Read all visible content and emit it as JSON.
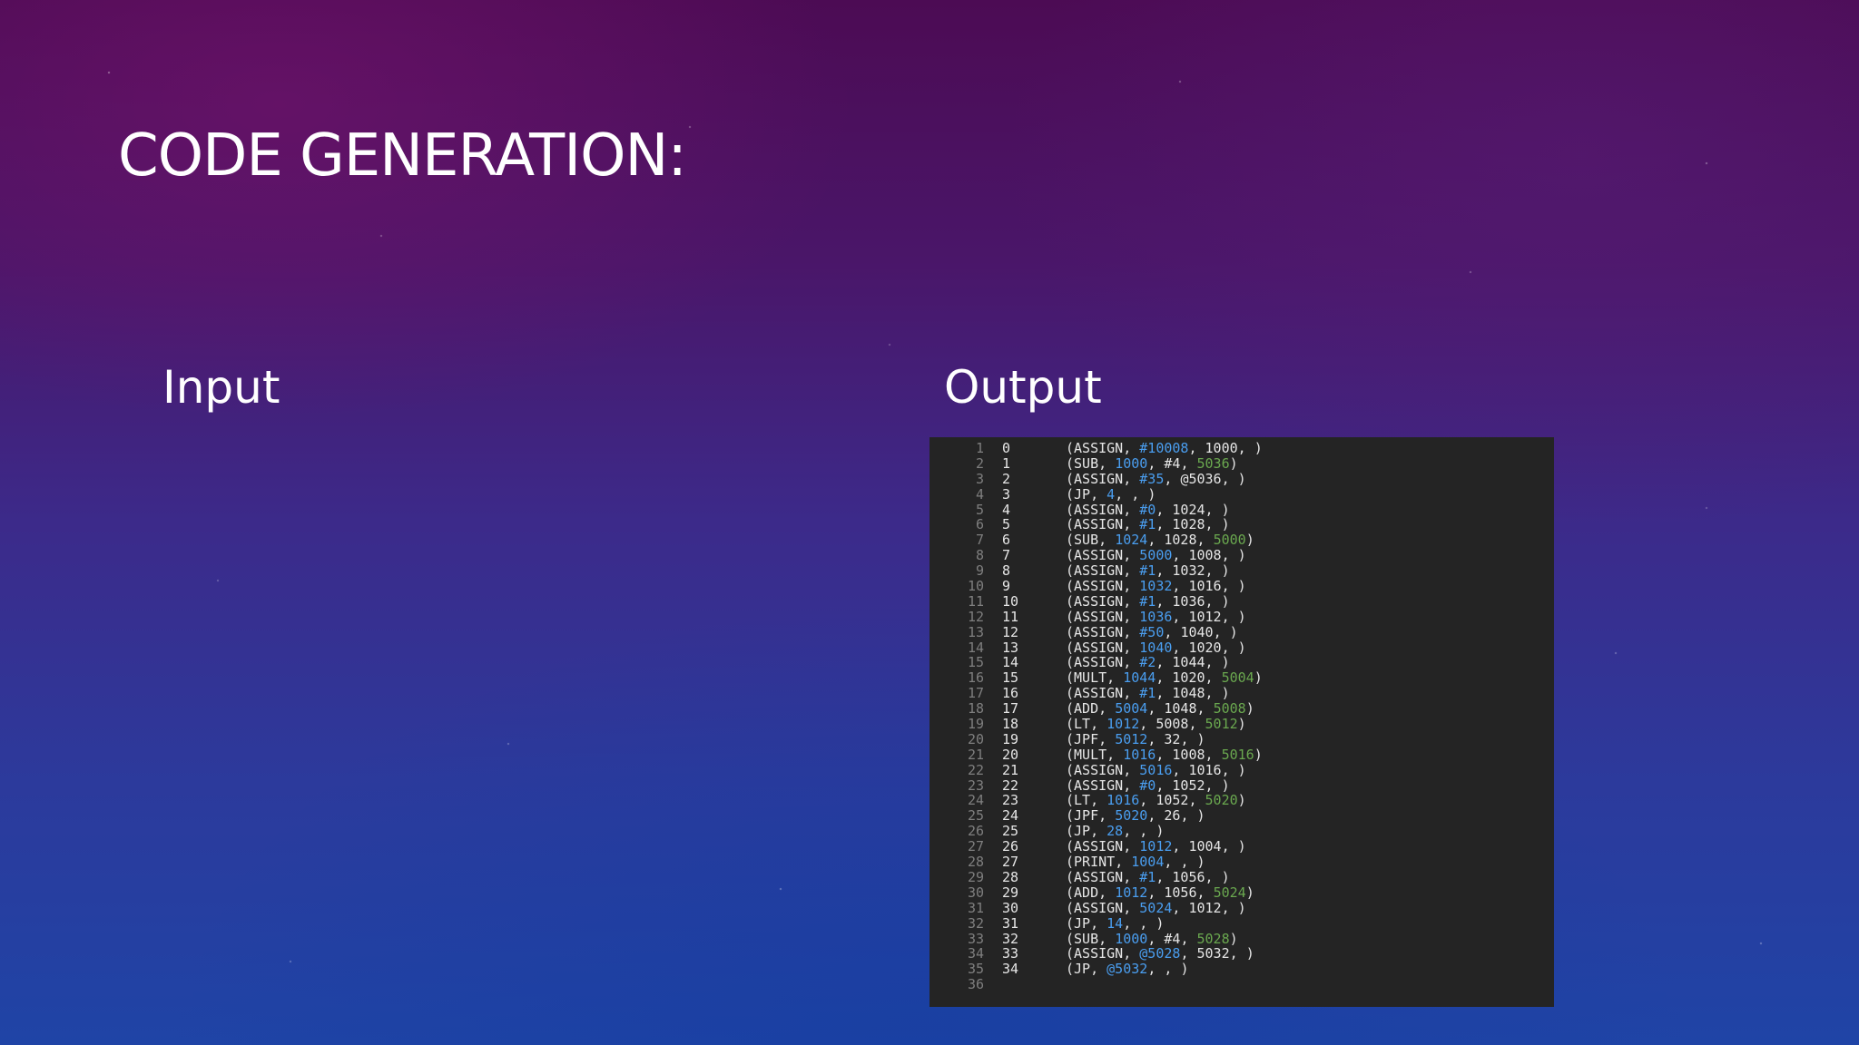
{
  "slide": {
    "title": "CODE GENERATION:",
    "input_heading": "Input",
    "output_heading": "Output"
  },
  "code": {
    "lines": [
      {
        "ln": "1",
        "idx": "0",
        "op": "ASSIGN",
        "a": "#10008",
        "b": "1000",
        "c": ""
      },
      {
        "ln": "2",
        "idx": "1",
        "op": "SUB",
        "a": "1000",
        "b": "#4",
        "c": "5036"
      },
      {
        "ln": "3",
        "idx": "2",
        "op": "ASSIGN",
        "a": "#35",
        "b": "@5036",
        "c": ""
      },
      {
        "ln": "4",
        "idx": "3",
        "op": "JP",
        "a": "4",
        "b": "",
        "c": ""
      },
      {
        "ln": "5",
        "idx": "4",
        "op": "ASSIGN",
        "a": "#0",
        "b": "1024",
        "c": ""
      },
      {
        "ln": "6",
        "idx": "5",
        "op": "ASSIGN",
        "a": "#1",
        "b": "1028",
        "c": ""
      },
      {
        "ln": "7",
        "idx": "6",
        "op": "SUB",
        "a": "1024",
        "b": "1028",
        "c": "5000"
      },
      {
        "ln": "8",
        "idx": "7",
        "op": "ASSIGN",
        "a": "5000",
        "b": "1008",
        "c": ""
      },
      {
        "ln": "9",
        "idx": "8",
        "op": "ASSIGN",
        "a": "#1",
        "b": "1032",
        "c": ""
      },
      {
        "ln": "10",
        "idx": "9",
        "op": "ASSIGN",
        "a": "1032",
        "b": "1016",
        "c": ""
      },
      {
        "ln": "11",
        "idx": "10",
        "op": "ASSIGN",
        "a": "#1",
        "b": "1036",
        "c": ""
      },
      {
        "ln": "12",
        "idx": "11",
        "op": "ASSIGN",
        "a": "1036",
        "b": "1012",
        "c": ""
      },
      {
        "ln": "13",
        "idx": "12",
        "op": "ASSIGN",
        "a": "#50",
        "b": "1040",
        "c": ""
      },
      {
        "ln": "14",
        "idx": "13",
        "op": "ASSIGN",
        "a": "1040",
        "b": "1020",
        "c": ""
      },
      {
        "ln": "15",
        "idx": "14",
        "op": "ASSIGN",
        "a": "#2",
        "b": "1044",
        "c": ""
      },
      {
        "ln": "16",
        "idx": "15",
        "op": "MULT",
        "a": "1044",
        "b": "1020",
        "c": "5004"
      },
      {
        "ln": "17",
        "idx": "16",
        "op": "ASSIGN",
        "a": "#1",
        "b": "1048",
        "c": ""
      },
      {
        "ln": "18",
        "idx": "17",
        "op": "ADD",
        "a": "5004",
        "b": "1048",
        "c": "5008"
      },
      {
        "ln": "19",
        "idx": "18",
        "op": "LT",
        "a": "1012",
        "b": "5008",
        "c": "5012"
      },
      {
        "ln": "20",
        "idx": "19",
        "op": "JPF",
        "a": "5012",
        "b": "32",
        "c": ""
      },
      {
        "ln": "21",
        "idx": "20",
        "op": "MULT",
        "a": "1016",
        "b": "1008",
        "c": "5016"
      },
      {
        "ln": "22",
        "idx": "21",
        "op": "ASSIGN",
        "a": "5016",
        "b": "1016",
        "c": ""
      },
      {
        "ln": "23",
        "idx": "22",
        "op": "ASSIGN",
        "a": "#0",
        "b": "1052",
        "c": ""
      },
      {
        "ln": "24",
        "idx": "23",
        "op": "LT",
        "a": "1016",
        "b": "1052",
        "c": "5020"
      },
      {
        "ln": "25",
        "idx": "24",
        "op": "JPF",
        "a": "5020",
        "b": "26",
        "c": ""
      },
      {
        "ln": "26",
        "idx": "25",
        "op": "JP",
        "a": "28",
        "b": "",
        "c": ""
      },
      {
        "ln": "27",
        "idx": "26",
        "op": "ASSIGN",
        "a": "1012",
        "b": "1004",
        "c": ""
      },
      {
        "ln": "28",
        "idx": "27",
        "op": "PRINT",
        "a": "1004",
        "b": "",
        "c": ""
      },
      {
        "ln": "29",
        "idx": "28",
        "op": "ASSIGN",
        "a": "#1",
        "b": "1056",
        "c": ""
      },
      {
        "ln": "30",
        "idx": "29",
        "op": "ADD",
        "a": "1012",
        "b": "1056",
        "c": "5024"
      },
      {
        "ln": "31",
        "idx": "30",
        "op": "ASSIGN",
        "a": "5024",
        "b": "1012",
        "c": ""
      },
      {
        "ln": "32",
        "idx": "31",
        "op": "JP",
        "a": "14",
        "b": "",
        "c": ""
      },
      {
        "ln": "33",
        "idx": "32",
        "op": "SUB",
        "a": "1000",
        "b": "#4",
        "c": "5028"
      },
      {
        "ln": "34",
        "idx": "33",
        "op": "ASSIGN",
        "a": "@5028",
        "b": "5032",
        "c": ""
      },
      {
        "ln": "35",
        "idx": "34",
        "op": "JP",
        "a": "@5032",
        "b": "",
        "c": ""
      },
      {
        "ln": "36",
        "idx": "",
        "op": "",
        "a": "",
        "b": "",
        "c": ""
      }
    ]
  },
  "colors": {
    "panel_bg": "#242424",
    "gutter_text": "#7f7f7f",
    "default_text": "#e6e6e6",
    "arg1_blue": "#4a9ef0",
    "arg3_green": "#6aa84f"
  }
}
